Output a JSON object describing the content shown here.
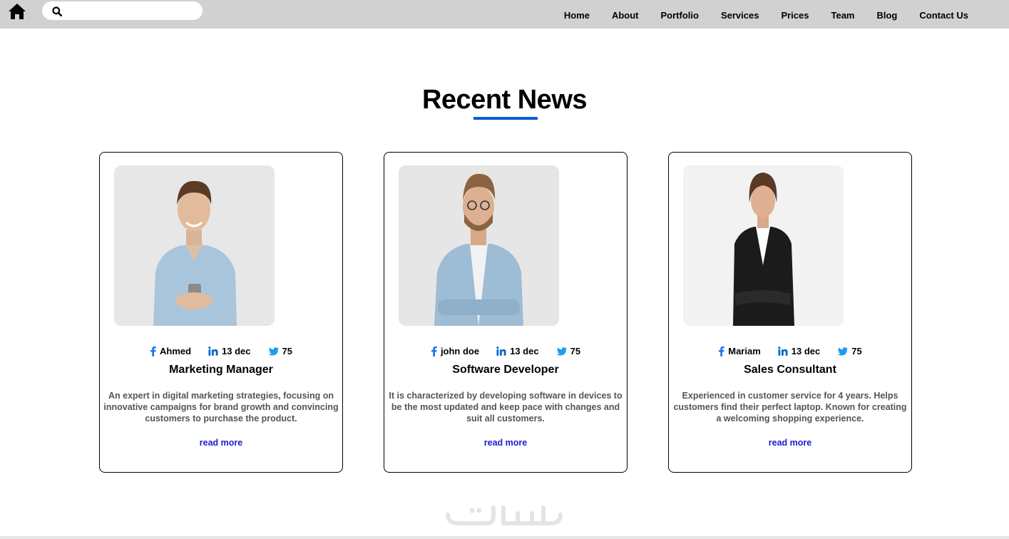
{
  "header": {
    "home_icon": "home-icon",
    "search_icon": "search-icon",
    "search_placeholder": "",
    "nav": [
      "Home",
      "About",
      "Portfolio",
      "Services",
      "Prices",
      "Team",
      "Blog",
      "Contact Us"
    ]
  },
  "section": {
    "title": "Recent News",
    "accent_color": "#0b5ed7"
  },
  "cards": [
    {
      "author": "Ahmed",
      "date": "13 dec",
      "count": "75",
      "role": "Marketing Manager",
      "description": "An expert in digital marketing strategies, focusing on innovative campaigns for brand growth and convincing customers to purchase the product.",
      "link": "read more"
    },
    {
      "author": "john doe",
      "date": "13 dec",
      "count": "75",
      "role": "Software Developer",
      "description": "It is characterized by developing software in devices to be the most updated and keep pace with changes and suit all customers.",
      "link": "read more"
    },
    {
      "author": "Mariam",
      "date": "13 dec",
      "count": "75",
      "role": "Sales Consultant",
      "description": "Experienced in customer service for 4 years. Helps customers find their perfect laptop. Known for creating a welcoming shopping experience.",
      "link": "read more"
    }
  ],
  "icons": {
    "facebook": "facebook-icon",
    "linkedin": "linkedin-icon",
    "twitter": "twitter-icon"
  },
  "colors": {
    "facebook": "#1877f2",
    "linkedin": "#0a66c2",
    "twitter": "#1d9bf0",
    "link": "#1a1ad4"
  }
}
